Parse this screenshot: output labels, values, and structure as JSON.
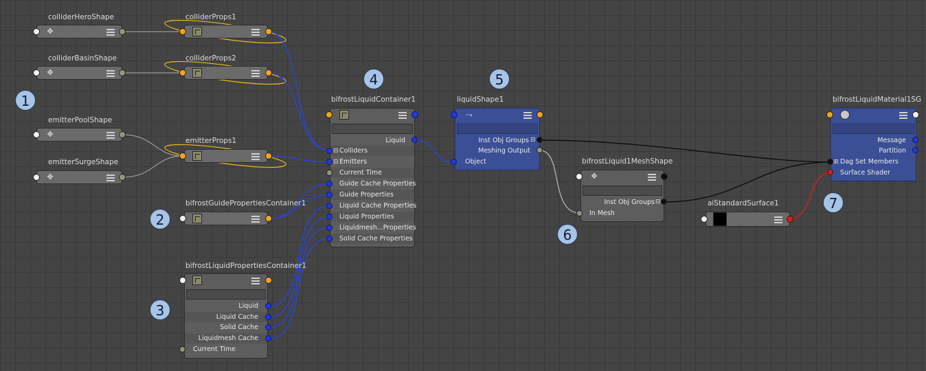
{
  "nodes": {
    "collider_hero_shape": {
      "title": "colliderHeroShape"
    },
    "collider_basin_shape": {
      "title": "colliderBasinShape"
    },
    "emitter_pool_shape": {
      "title": "emitterPoolShape"
    },
    "emitter_surge_shape": {
      "title": "emitterSurgeShape"
    },
    "collider_props1": {
      "title": "colliderProps1"
    },
    "collider_props2": {
      "title": "colliderProps2"
    },
    "emitter_props1": {
      "title": "emitterProps1"
    },
    "guide_props_container": {
      "title": "bifrostGuidePropertiesContainer1"
    },
    "liquid_props_container": {
      "title": "bifrostLiquidPropertiesContainer1",
      "outputs": [
        "Liquid",
        "Liquid Cache",
        "Solid Cache",
        "Liquidmesh Cache"
      ],
      "input": "Current Time"
    },
    "liquid_container": {
      "title": "bifrostLiquidContainer1",
      "output": "Liquid",
      "inputs": [
        "Colliders",
        "Emitters",
        "Current Time",
        "Guide Cache Properties",
        "Guide Properties",
        "Liquid Cache Properties",
        "Liquid Properties",
        "Liquidmesh...Properties",
        "Solid Cache Properties"
      ]
    },
    "liquid_shape": {
      "title": "liquidShape1",
      "outputs": [
        "Inst Obj Groups",
        "Meshing Output"
      ],
      "input": "Object"
    },
    "mesh_shape": {
      "title": "bifrostLiquid1MeshShape",
      "output": "Inst Obj Groups",
      "input": "In Mesh"
    },
    "standard_surface": {
      "title": "aiStandardSurface1"
    },
    "material_sg": {
      "title": "bifrostLiquidMaterial1SG",
      "outputs": [
        "Message",
        "Partition"
      ],
      "inputs": [
        "Dag Set Members",
        "Surface Shader"
      ]
    }
  },
  "callouts": [
    "1",
    "2",
    "3",
    "4",
    "5",
    "6",
    "7"
  ],
  "colors": {
    "background": "#444444",
    "node_gray": "#5d5d5d",
    "node_blue": "#3b4f96",
    "port_orange": "#f4a21d",
    "port_blue": "#2338d6",
    "port_red": "#e01a1a",
    "wire_blue": "#2a45d6",
    "wire_yellow": "#e8b820",
    "callout": "#a7c4e6"
  }
}
